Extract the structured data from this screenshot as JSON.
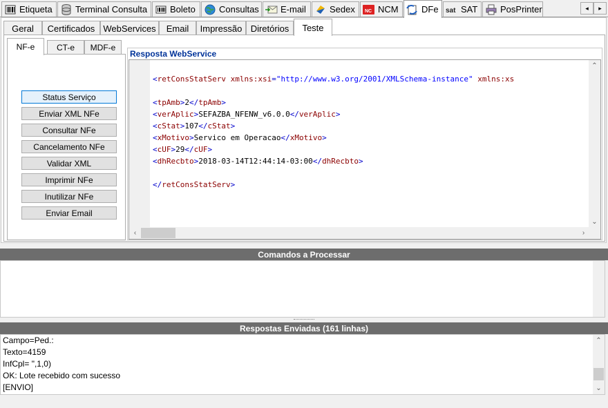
{
  "main_tabs": [
    {
      "label": "Etiqueta",
      "icon": "barcode-icon"
    },
    {
      "label": "Terminal Consulta",
      "icon": "database-icon"
    },
    {
      "label": "Boleto",
      "icon": "barcode-card-icon"
    },
    {
      "label": "Consultas",
      "icon": "globe-icon"
    },
    {
      "label": "E-mail",
      "icon": "email-icon"
    },
    {
      "label": "Sedex",
      "icon": "sedex-icon"
    },
    {
      "label": "NCM",
      "icon": "ncm-icon"
    },
    {
      "label": "DFe",
      "icon": "dfe-icon",
      "active": true
    },
    {
      "label": "SAT",
      "icon": "sat-icon"
    },
    {
      "label": "PosPrinter",
      "icon": "printer-icon"
    }
  ],
  "tab_scroll": {
    "left": "◂",
    "right": "▸"
  },
  "sub_tabs": [
    {
      "label": "Geral"
    },
    {
      "label": "Certificados"
    },
    {
      "label": "WebServices"
    },
    {
      "label": "Email"
    },
    {
      "label": "Impressão"
    },
    {
      "label": "Diretórios"
    },
    {
      "label": "Teste",
      "active": true
    }
  ],
  "doc_tabs": [
    {
      "label": "NF-e",
      "active": true
    },
    {
      "label": "CT-e"
    },
    {
      "label": "MDF-e"
    }
  ],
  "actions": [
    "Status Serviço",
    "Enviar XML NFe",
    "Consultar NFe",
    "Cancelamento NFe",
    "Validar XML",
    "Imprimir NFe",
    "Inutilizar NFe",
    "Enviar Email"
  ],
  "response": {
    "title": "Resposta WebService",
    "xml": {
      "root_open": "<retConsStatServ xmlns:xsi=\"http://www.w3.org/2001/XMLSchema-instance\" xmlns:xs",
      "root_tag": "retConsStatServ",
      "attr1_name": "xmlns:xsi",
      "attr1_value": "\"http://www.w3.org/2001/XMLSchema-instance\"",
      "attr2_name": "xmlns:xs",
      "fields": [
        {
          "tag": "tpAmb",
          "value": "2"
        },
        {
          "tag": "verAplic",
          "value": "SEFAZBA_NFENW_v6.0.0"
        },
        {
          "tag": "cStat",
          "value": "107"
        },
        {
          "tag": "xMotivo",
          "value": "Servico em Operacao"
        },
        {
          "tag": "cUF",
          "value": "29"
        },
        {
          "tag": "dhRecbto",
          "value": "2018-03-14T12:44:14-03:00"
        }
      ]
    }
  },
  "commands": {
    "title": "Comandos a Processar",
    "lines": []
  },
  "responses": {
    "title": "Respostas Enviadas (161 linhas)",
    "lines": [
      "Campo=Ped.:",
      "Texto=4159",
      "InfCpl= \",1,0)",
      "OK: Lote recebido com sucesso",
      "[ENVIO]"
    ]
  },
  "colors": {
    "section_bar": "#6d6d6d",
    "xml_tag": "#8b0000",
    "xml_bracket": "#0000cc",
    "xml_attr_value": "#0000ff",
    "title_blue": "#003399"
  }
}
